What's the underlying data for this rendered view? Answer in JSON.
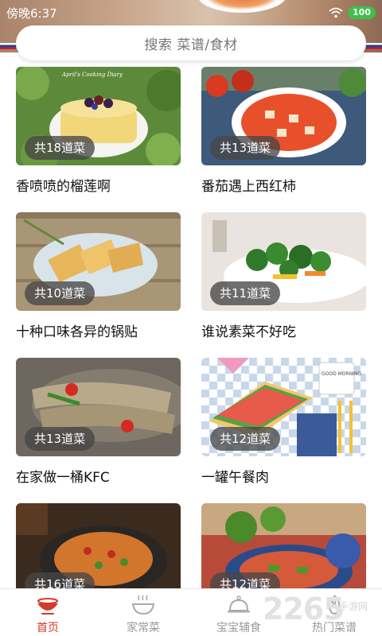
{
  "status_bar": {
    "time": "傍晚6:37",
    "battery": "100"
  },
  "search": {
    "placeholder": "搜索 菜谱/食材"
  },
  "cards": [
    {
      "badge": "共18道菜",
      "title": "香喷喷的榴莲啊"
    },
    {
      "badge": "共13道菜",
      "title": "番茄遇上西红柿"
    },
    {
      "badge": "共10道菜",
      "title": "十种口味各异的锅贴"
    },
    {
      "badge": "共11道菜",
      "title": "谁说素菜不好吃"
    },
    {
      "badge": "共13道菜",
      "title": "在家做一桶KFC"
    },
    {
      "badge": "共12道菜",
      "title": "一罐午餐肉"
    },
    {
      "badge": "共16道菜",
      "title": ""
    },
    {
      "badge": "共12道菜",
      "title": ""
    }
  ],
  "card_image_labels": {
    "cake_caption": "April's Cooking Diary",
    "mug_caption": "GOOD MORNING"
  },
  "bottom_nav": [
    {
      "label": "首页",
      "icon": "pot-icon",
      "active": true
    },
    {
      "label": "家常菜",
      "icon": "bowl-icon",
      "active": false
    },
    {
      "label": "宝宝辅食",
      "icon": "cloche-icon",
      "active": false
    },
    {
      "label": "热门菜谱",
      "icon": "fire-icon",
      "active": false
    }
  ],
  "watermark": {
    "number": "2265",
    "suffix": "手游网"
  },
  "colors": {
    "accent": "#d63a2a",
    "badge_bg": "#464646",
    "battery": "#3cc04a"
  }
}
